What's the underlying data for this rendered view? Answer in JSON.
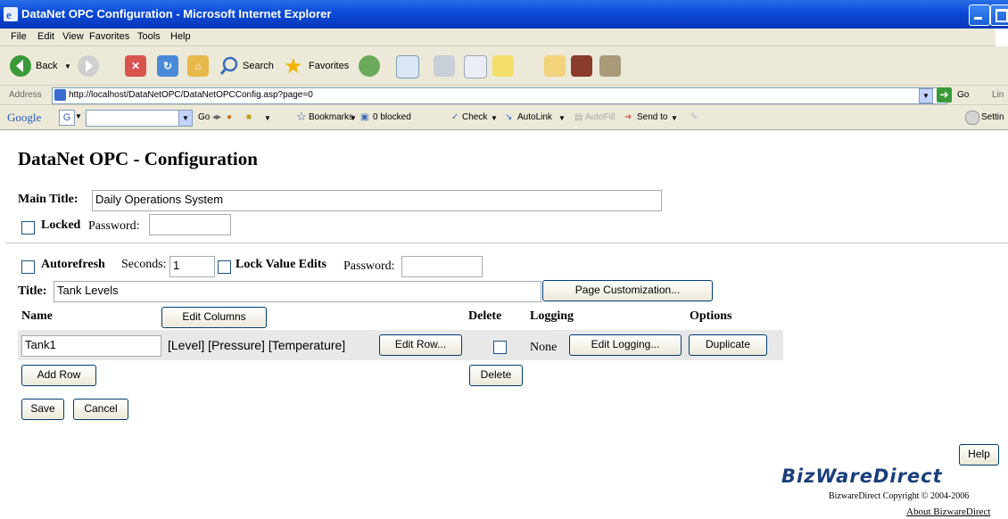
{
  "window": {
    "title": "DataNet OPC Configuration - Microsoft Internet Explorer"
  },
  "menu": [
    "File",
    "Edit",
    "View",
    "Favorites",
    "Tools",
    "Help"
  ],
  "toolbar": {
    "back": "Back",
    "search": "Search",
    "favorites": "Favorites"
  },
  "address": {
    "label": "Address",
    "url": "http://localhost/DataNetOPC/DataNetOPCConfig.asp?page=0",
    "go": "Go",
    "links": "Lin"
  },
  "google_bar": {
    "logo": "Google",
    "go": "Go",
    "bookmarks": "Bookmarks",
    "blocked": "0 blocked",
    "check": "Check",
    "autolink": "AutoLink",
    "autofill": "AutoFill",
    "sendto": "Send to",
    "settings": "Settin"
  },
  "page": {
    "heading": "DataNet OPC - Configuration",
    "main_title_label": "Main Title:",
    "main_title_value": "Daily Operations System",
    "locked_label": "Locked",
    "password_label": "Password:",
    "autorefresh_label": "Autorefresh",
    "seconds_label": "Seconds:",
    "seconds_value": "1",
    "lock_value_edits_label": "Lock Value Edits",
    "password2_label": "Password:",
    "title_label": "Title:",
    "title_value": "Tank Levels",
    "page_customization_button": "Page Customization...",
    "columns": {
      "name": "Name",
      "delete": "Delete",
      "logging": "Logging",
      "options": "Options"
    },
    "edit_columns_button": "Edit Columns",
    "rows": [
      {
        "name": "Tank1",
        "columns": "[Level] [Pressure] [Temperature]",
        "edit_row": "Edit Row...",
        "logging": "None",
        "edit_logging": "Edit Logging...",
        "duplicate": "Duplicate"
      }
    ],
    "add_row_button": "Add Row",
    "delete_button": "Delete",
    "save_button": "Save",
    "cancel_button": "Cancel",
    "help_button": "Help",
    "logo_text": "BizWareDirect",
    "copyright": "BizwareDirect Copyright © 2004-2006",
    "about_link": "About BizwareDirect"
  }
}
